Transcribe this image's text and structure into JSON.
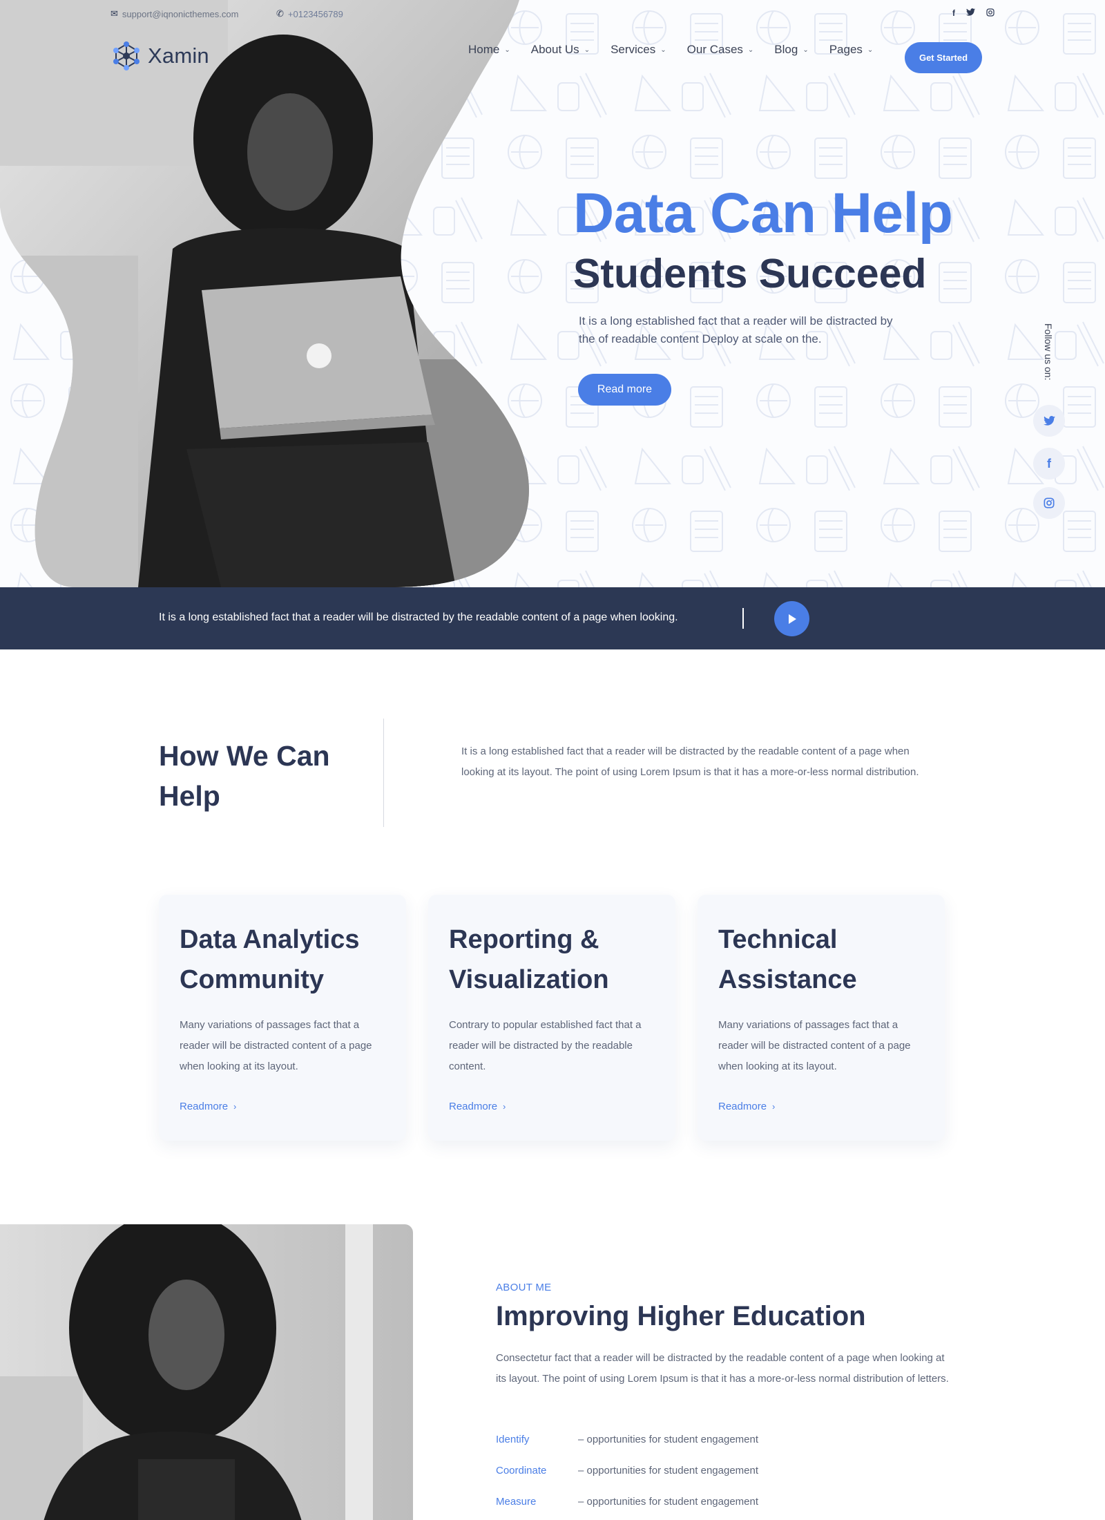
{
  "topbar": {
    "email": "support@iqnonicthemes.com",
    "phone": "+0123456789",
    "social_icons": [
      "facebook-icon",
      "twitter-icon",
      "instagram-icon"
    ]
  },
  "brand": {
    "name": "Xamin",
    "accent": "#4a7ee6",
    "dark": "#2c3854"
  },
  "nav": {
    "items": [
      "Home",
      "About Us",
      "Services",
      "Our Cases",
      "Blog",
      "Pages"
    ],
    "cta": "Get Started"
  },
  "hero": {
    "title_line1": "Data Can Help",
    "title_line2": "Students Succeed",
    "description": "It is a long established fact that a reader will be distracted by the of readable content Deploy at scale on the.",
    "button": "Read more",
    "follow_label": "Follow us on:",
    "follow_icons": [
      "twitter-icon",
      "facebook-icon",
      "instagram-icon"
    ]
  },
  "banner": {
    "text": "It is a long established fact that a reader will be distracted by the readable content of a page when looking."
  },
  "help": {
    "title": "How We Can Help",
    "description": "It is a long established fact that a reader will be distracted by the readable content of a page when looking at its layout. The point of using Lorem Ipsum is that it has a more-or-less normal distribution."
  },
  "cards": [
    {
      "title": "Data Analytics Community",
      "description": "Many variations of passages fact that a reader will be distracted content of a page when looking at its layout.",
      "link": "Readmore"
    },
    {
      "title": "Reporting & Visualization",
      "description": "Contrary to popular established fact that a reader will be distracted by the readable content.",
      "link": "Readmore"
    },
    {
      "title": "Technical Assistance",
      "description": "Many variations of passages fact that a reader will be distracted content of a page when looking at its layout.",
      "link": "Readmore"
    }
  ],
  "about": {
    "eyebrow": "ABOUT ME",
    "title": "Improving Higher Education",
    "description": "Consectetur fact that a reader will be distracted by the readable content of a page when looking at its layout. The point of using Lorem Ipsum is that it has a more-or-less normal distribution of letters.",
    "items": [
      {
        "key": "Identify",
        "value": "– opportunities for student engagement"
      },
      {
        "key": "Coordinate",
        "value": "– opportunities for student engagement"
      },
      {
        "key": "Measure",
        "value": "– opportunities for student engagement"
      }
    ]
  }
}
